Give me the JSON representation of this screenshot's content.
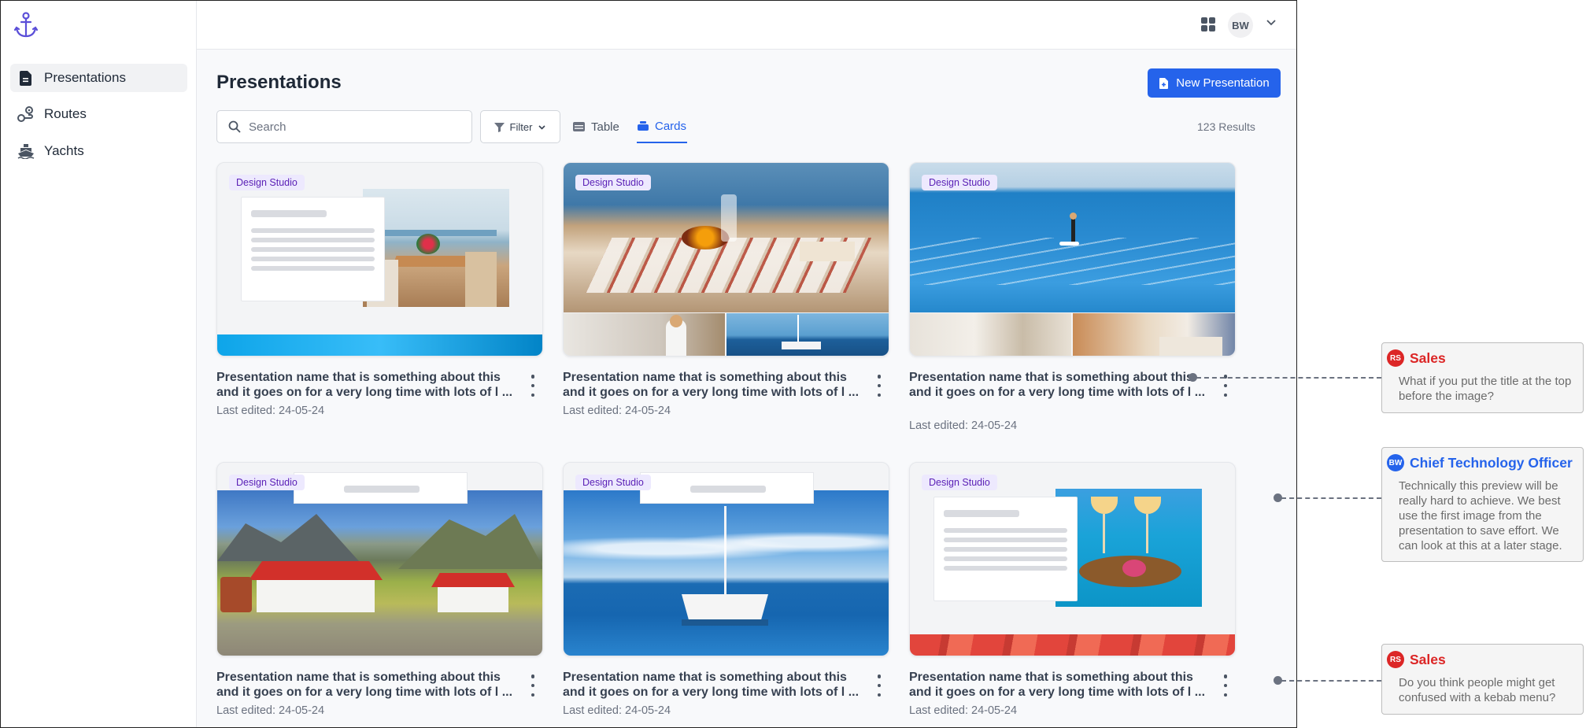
{
  "sidebar": {
    "items": [
      {
        "label": "Presentations",
        "icon": "document-icon",
        "active": true
      },
      {
        "label": "Routes",
        "icon": "route-icon",
        "active": false
      },
      {
        "label": "Yachts",
        "icon": "ship-icon",
        "active": false
      }
    ]
  },
  "topbar": {
    "avatar_initials": "BW"
  },
  "page": {
    "title": "Presentations",
    "new_button": "New Presentation",
    "search_placeholder": "Search",
    "filter_label": "Filter",
    "tabs": [
      {
        "label": "Table",
        "active": false
      },
      {
        "label": "Cards",
        "active": true
      }
    ],
    "results": "123 Results"
  },
  "cards": [
    {
      "badge": "Design Studio",
      "title": "Presentation name that is something about this and it goes on for a very long time with lots of l ...",
      "meta": "Last edited: 24-05-24"
    },
    {
      "badge": "Design Studio",
      "title": "Presentation name that is something about this and it goes on for a very long time with lots of l ...",
      "meta": "Last edited: 24-05-24"
    },
    {
      "badge": "Design Studio",
      "title": "Presentation name that is something about this and it goes on for a very long time with lots of l ...",
      "meta": "Last edited: 24-05-24"
    },
    {
      "badge": "Design Studio",
      "title": "Presentation name that is something about this and it goes on for a very long time with lots of l ...",
      "meta": "Last edited: 24-05-24"
    },
    {
      "badge": "Design Studio",
      "title": "Presentation name that is something about this and it goes on for a very long time with lots of l ...",
      "meta": "Last edited: 24-05-24"
    },
    {
      "badge": "Design Studio",
      "title": "Presentation name that is something about this and it goes on for a very long time with lots of l ...",
      "meta": "Last edited: 24-05-24"
    }
  ],
  "annotations": [
    {
      "initials": "RS",
      "author": "Sales",
      "color": "#dc2626",
      "text": "What if you put the title at the top before the image?"
    },
    {
      "initials": "BW",
      "author": "Chief Technology Officer",
      "color": "#2563eb",
      "text": "Technically this preview will be really hard to achieve. We best use the first image from the presentation to save effort. We can look at this at a later stage."
    },
    {
      "initials": "RS",
      "author": "Sales",
      "color": "#dc2626",
      "text": "Do you think people might get confused with a kebab menu?"
    }
  ],
  "colors": {
    "accent": "#2563eb",
    "badge_bg": "#ede9fe",
    "badge_text": "#5b21b6"
  }
}
